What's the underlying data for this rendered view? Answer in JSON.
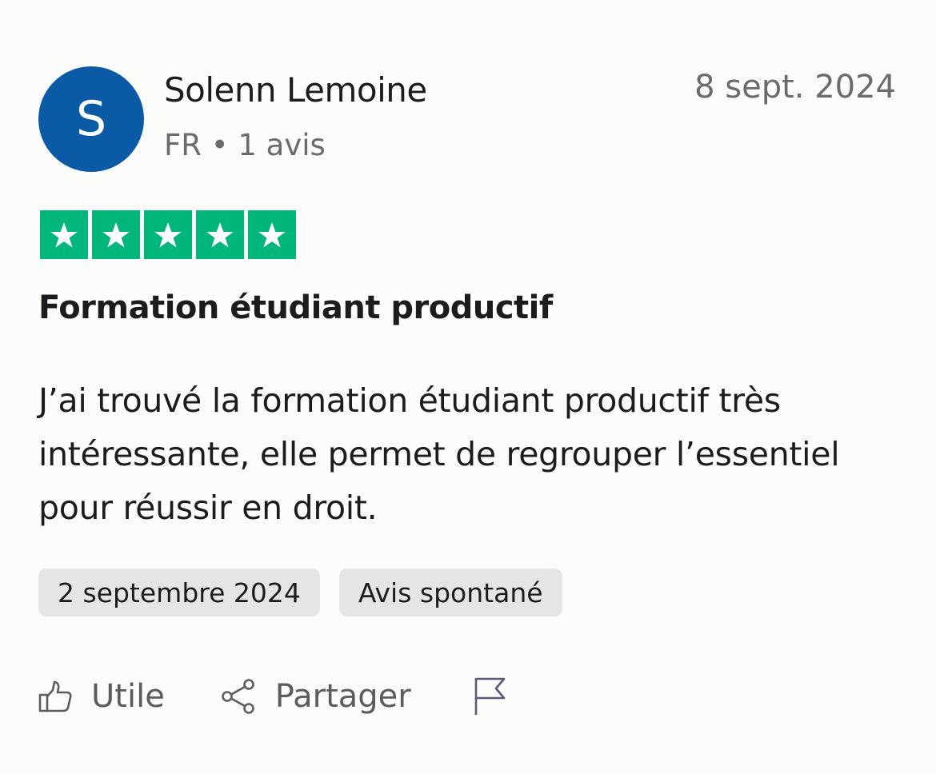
{
  "review": {
    "avatar_letter": "S",
    "author_name": "Solenn Lemoine",
    "author_meta": "FR • 1 avis",
    "published_date": "8 sept. 2024",
    "rating": 5,
    "rating_max": 5,
    "title": "Formation étudiant productif",
    "body": "J’ai trouvé la formation étudiant productif très intéressante, elle permet de regrouper l’essentiel pour réussir en droit.",
    "tags": {
      "experience_date": "2 septembre 2024",
      "review_type": "Avis spontané"
    }
  },
  "actions": {
    "useful_label": "Utile",
    "share_label": "Partager"
  },
  "colors": {
    "avatar": "#0b5aa6",
    "star_bg": "#00b67a",
    "tag_bg": "#e5e5e5",
    "flag_icon": "#5a5a7a"
  },
  "icons": [
    "thumbs-up-icon",
    "share-icon",
    "flag-icon",
    "star-icon"
  ]
}
